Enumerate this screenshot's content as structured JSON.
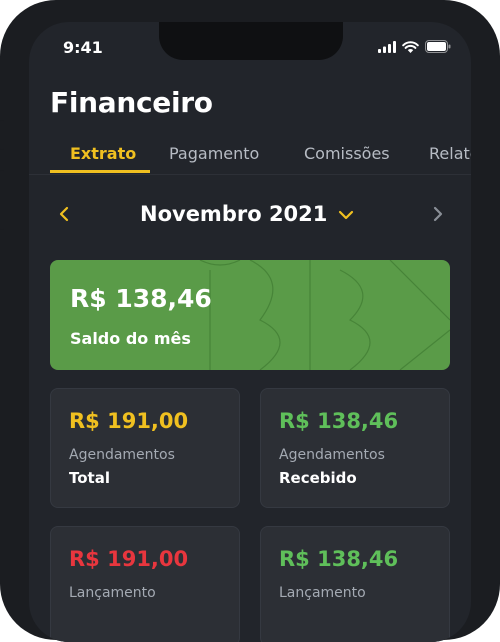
{
  "status_bar": {
    "time": "9:41"
  },
  "header": {
    "title": "Financeiro"
  },
  "tabs": [
    {
      "label": "Extrato",
      "active": true
    },
    {
      "label": "Pagamento"
    },
    {
      "label": "Comissões"
    },
    {
      "label": "Relatórios"
    }
  ],
  "period": {
    "month": "Novembro 2021"
  },
  "balance": {
    "value": "R$ 138,46",
    "label": "Saldo do mês"
  },
  "cards": [
    {
      "value": "R$ 191,00",
      "sub": "Agendamentos",
      "label": "Total",
      "color": "#f0c020"
    },
    {
      "value": "R$ 138,46",
      "sub": "Agendamentos",
      "label": "Recebido",
      "color": "#5fbf5a"
    },
    {
      "value": "R$ 191,00",
      "sub": "Lançamento",
      "label": "",
      "color": "#e8363e"
    },
    {
      "value": "R$ 138,46",
      "sub": "Lançamento",
      "label": "",
      "color": "#5fbf5a"
    }
  ],
  "colors": {
    "accent": "#f0c020",
    "positive": "#5fbf5a",
    "negative": "#e8363e",
    "balance_card": "#5a9b48"
  }
}
